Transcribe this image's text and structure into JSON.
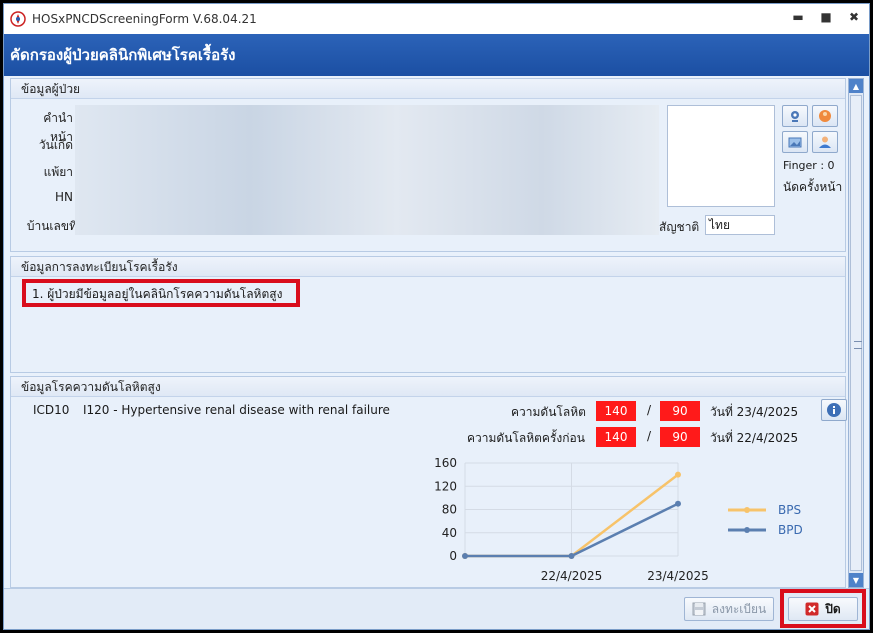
{
  "window": {
    "title": "HOSxPNCDScreeningForm V.68.04.21",
    "controls": {
      "minimize": "▬",
      "maximize": "■",
      "close": "✖"
    }
  },
  "header": {
    "title": "คัดกรองผู้ป่วยคลินิกพิเศษโรคเรื้อรัง"
  },
  "patient": {
    "section_title": "ข้อมูลผู้ป่วย",
    "labels": {
      "prefix": "คำนำหน้า",
      "birthdate": "วันเกิด",
      "doctor": "แพ้ยา",
      "hn": "HN",
      "address": "บ้านเลขที่",
      "nationality": "สัญชาติ"
    },
    "nationality_value": "ไทย",
    "finger_text": "Finger : 0",
    "next_appointment": "นัดครั้งหน้า"
  },
  "registration": {
    "section_title": "ข้อมูลการลงทะเบียนโรคเรื้อรัง",
    "items": [
      "1. ผู้ป่วยมีข้อมูลอยู่ในคลินิกโรคความดันโลหิตสูง"
    ]
  },
  "hypertension": {
    "section_title": "ข้อมูลโรคความดันโลหิตสูง",
    "icd_label": "ICD10",
    "icd_text": "I120 - Hypertensive renal disease with renal failure",
    "bp_label": "ความดันโลหิต",
    "bp_sys": "140",
    "bp_sep": "/",
    "bp_dia": "90",
    "bp_date": "วันที่ 23/4/2025",
    "prev_bp_label": "ความดันโลหิตครั้งก่อน",
    "prev_bp_sys": "140",
    "prev_bp_sep": "/",
    "prev_bp_dia": "90",
    "prev_bp_date": "วันที่ 22/4/2025"
  },
  "chart_data": {
    "type": "line",
    "categories": [
      "",
      "22/4/2025",
      "23/4/2025"
    ],
    "series": [
      {
        "name": "BPS",
        "values": [
          0,
          0,
          140
        ],
        "color": "#f7c36a"
      },
      {
        "name": "BPD",
        "values": [
          0,
          0,
          90
        ],
        "color": "#5b7fb0"
      }
    ],
    "yticks": [
      0,
      40,
      80,
      120,
      160
    ],
    "ylim": [
      0,
      160
    ],
    "grid": true,
    "legend_position": "right"
  },
  "footer": {
    "register_label": "ลงทะเบียน",
    "close_label": "ปิด"
  },
  "colors": {
    "header_blue": "#1b4fa3",
    "highlight_red": "#d90d1c",
    "bp_red": "#ff1a1a"
  }
}
